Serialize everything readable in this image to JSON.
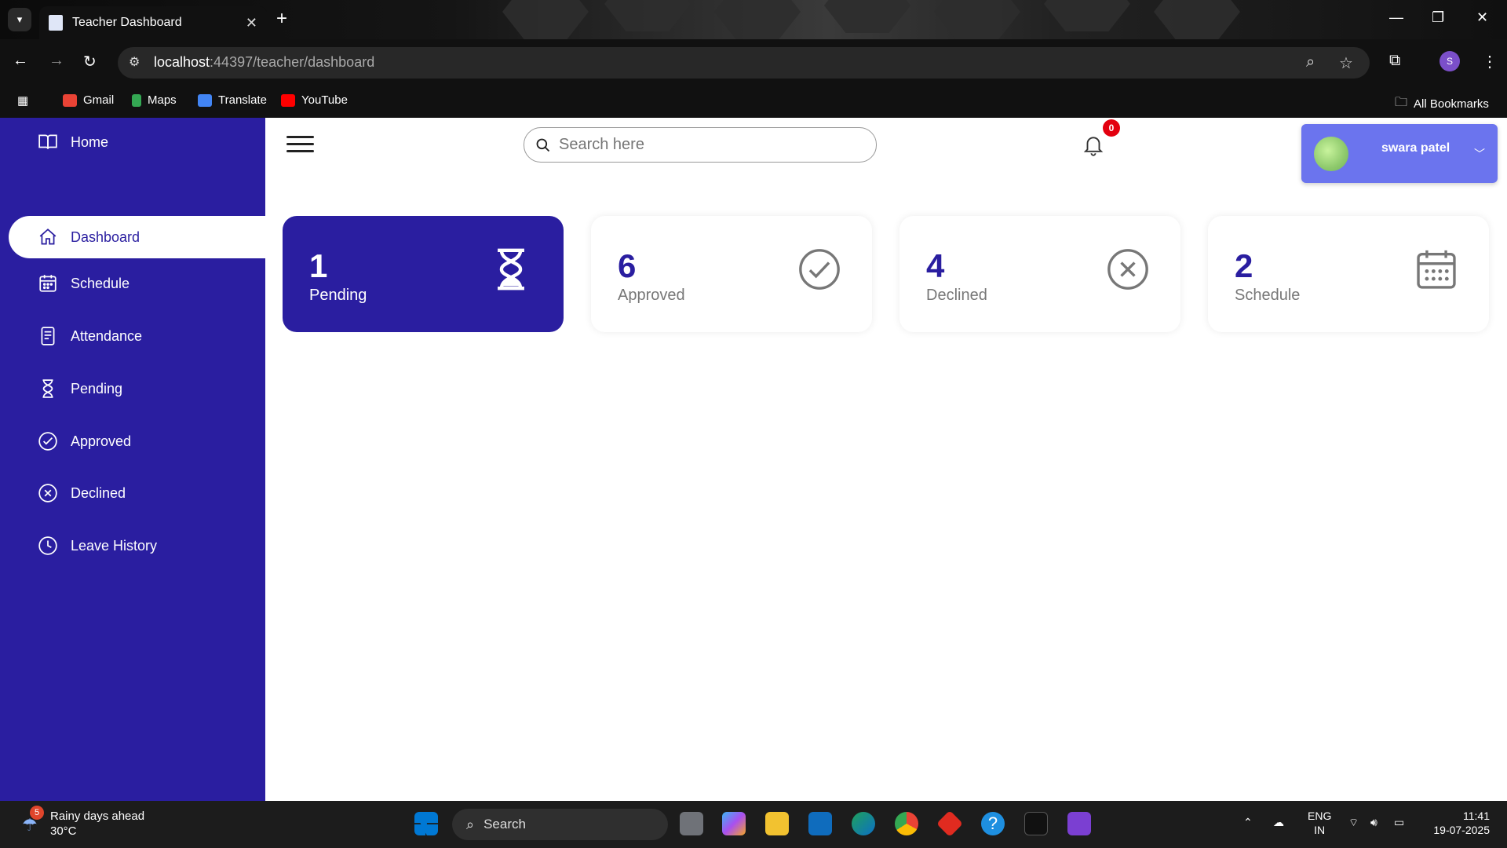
{
  "browser": {
    "tab_title": "Teacher Dashboard",
    "url_host": "localhost",
    "url_rest": ":44397/teacher/dashboard",
    "profile_letter": "S",
    "bookmarks": [
      "Gmail",
      "Maps",
      "Translate",
      "YouTube"
    ],
    "all_bookmarks": "All Bookmarks"
  },
  "sidebar": {
    "home": "Home",
    "items": [
      {
        "label": "Dashboard",
        "icon": "home-icon"
      },
      {
        "label": "Schedule",
        "icon": "calendar-icon"
      },
      {
        "label": "Attendance",
        "icon": "document-icon"
      },
      {
        "label": "Pending",
        "icon": "hourglass-icon"
      },
      {
        "label": "Approved",
        "icon": "check-circle-icon"
      },
      {
        "label": "Declined",
        "icon": "x-circle-icon"
      },
      {
        "label": "Leave History",
        "icon": "clock-icon"
      }
    ]
  },
  "header": {
    "search_placeholder": "Search here",
    "notifications_count": "0",
    "user_name": "swara patel"
  },
  "stats": [
    {
      "value": "1",
      "label": "Pending",
      "icon": "hourglass-icon"
    },
    {
      "value": "6",
      "label": "Approved",
      "icon": "check-circle-icon"
    },
    {
      "value": "4",
      "label": "Declined",
      "icon": "x-circle-icon"
    },
    {
      "value": "2",
      "label": "Schedule",
      "icon": "calendar-icon"
    }
  ],
  "colors": {
    "primary": "#2a1ea0",
    "user_card": "#6b74ee",
    "badge": "#e3000f"
  },
  "taskbar": {
    "weather_badge": "5",
    "weather_title": "Rainy days ahead",
    "weather_temp": "30°C",
    "search": "Search",
    "lang_top": "ENG",
    "lang_bottom": "IN",
    "time": "11:41",
    "date": "19-07-2025"
  }
}
